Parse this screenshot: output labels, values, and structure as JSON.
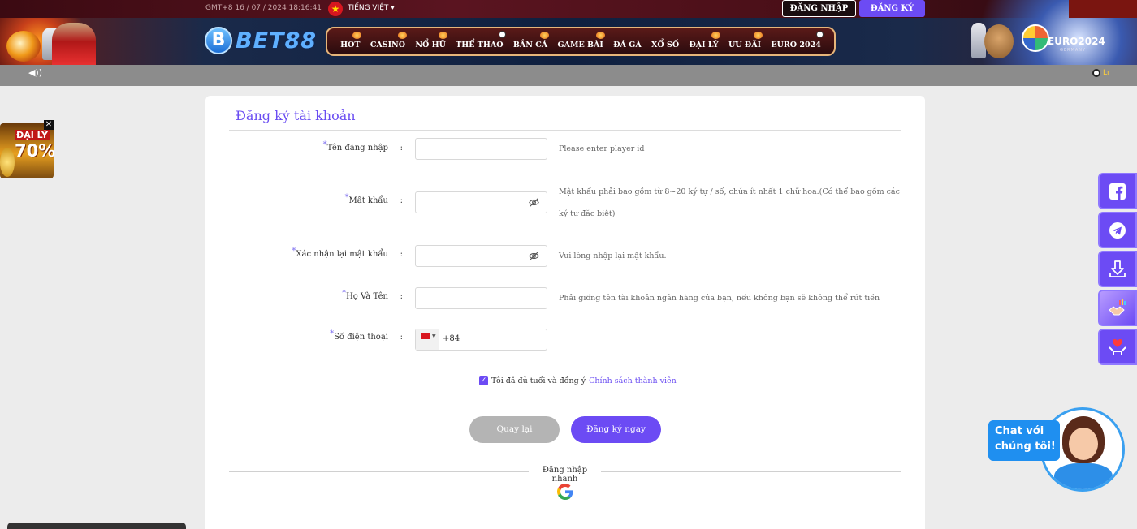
{
  "header": {
    "time": "GMT+8 16 / 07 / 2024 18:16:41",
    "language": "TIẾNG VIỆT ▾",
    "login_label": "ĐĂNG NHẬP",
    "register_label": "ĐĂNG KÝ",
    "logo_text": "BET88",
    "logo_letter": "B",
    "nav": [
      "HOT",
      "CASINO",
      "NỔ HŨ",
      "THỂ THAO",
      "BẮN CÁ",
      "GAME BÀI",
      "ĐÁ GÀ",
      "XỔ SỐ",
      "ĐẠI LÝ",
      "ƯU ĐÃI",
      "EURO 2024"
    ],
    "euro_text": "EURO2024",
    "euro_sub": "GERMANY"
  },
  "subbar": {
    "ticker_text": "Lı"
  },
  "form": {
    "title": "Đăng ký tài khoản",
    "fields": {
      "username": {
        "label": "Tên đăng nhập",
        "value": "",
        "hint": "Please enter player id"
      },
      "password": {
        "label": "Mật khẩu",
        "value": "",
        "hint_line1": "Mật khẩu phải bao gồm từ 8~20 ký tự / số, chứa ít nhất 1 chữ hoa.(Có thể bao gồm các",
        "hint_line2": "ký tự đặc biệt)"
      },
      "confirm": {
        "label": "Xác nhận lại mật khẩu",
        "value": "",
        "hint": "Vui lòng nhập lại mật khẩu."
      },
      "fullname": {
        "label": "Họ Và Tên",
        "value": "",
        "hint": "Phải giống tên tài khoản ngân hàng của bạn, nếu không bạn sẽ không thể rút tiền"
      },
      "phone": {
        "label": "Số điện thoại",
        "code": "+84",
        "value": ""
      }
    },
    "colon": ":",
    "agree_text": "Tôi đã đủ tuổi và đồng ý",
    "agree_link": "Chính sách thành viên",
    "agree_checked": true,
    "back_label": "Quay lại",
    "submit_label": "Đăng ký ngay",
    "quick_login": "Đăng nhập nhanh"
  },
  "ads": {
    "agent_line1": "ĐẠI LÝ",
    "agent_line2": "70%",
    "close": "✕"
  },
  "chat": {
    "line1": "Chat với",
    "line2": "chúng tôi!"
  },
  "colors": {
    "accent": "#6c4bf4",
    "title": "#6a4df2",
    "nav_border": "#e6b57a",
    "chat": "#1f8ff0"
  },
  "icons": {
    "side": [
      "facebook-icon",
      "telegram-icon",
      "download-icon",
      "agent-handshake-icon",
      "heart-hands-icon"
    ],
    "password_toggle": "eye-slash-icon",
    "social_login": "google-icon"
  }
}
